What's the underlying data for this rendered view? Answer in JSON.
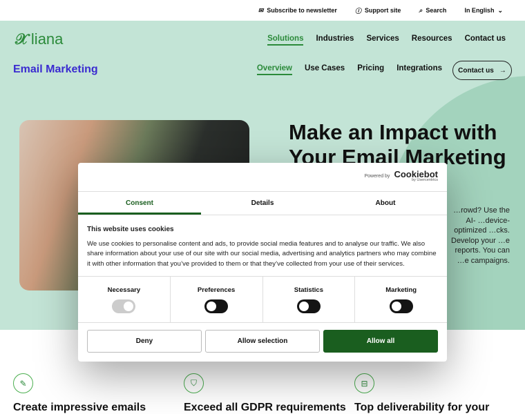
{
  "topbar": {
    "newsletter": "Subscribe to newsletter",
    "support": "Support site",
    "search": "Search",
    "language": "In English"
  },
  "brand": {
    "name": "liana",
    "accent": "#2b8a3a"
  },
  "nav": [
    "Solutions",
    "Industries",
    "Services",
    "Resources",
    "Contact us"
  ],
  "product": {
    "title": "Email Marketing",
    "subnav": [
      "Overview",
      "Use Cases",
      "Pricing",
      "Integrations"
    ],
    "contact": "Contact us"
  },
  "hero": {
    "title": "Make an Impact with Your Email Marketing",
    "lead": "…rowd? Use the AI- …device-optimized …cks. Develop your …e reports. You can …e campaigns."
  },
  "cookie": {
    "powered": "Powered by",
    "brand": "Cookiebot",
    "brand_sub": "by Usercentrics",
    "tabs": [
      "Consent",
      "Details",
      "About"
    ],
    "heading": "This website uses cookies",
    "text": "We use cookies to personalise content and ads, to provide social media features and to analyse our traffic. We also share information about your use of our site with our social media, advertising and analytics partners who may combine it with other information that you’ve provided to them or that they’ve collected from your use of their services.",
    "toggles": [
      "Necessary",
      "Preferences",
      "Statistics",
      "Marketing"
    ],
    "deny": "Deny",
    "allow_selection": "Allow selection",
    "allow_all": "Allow all"
  },
  "features": [
    "Create impressive emails",
    "Exceed all GDPR requirements",
    "Top deliverability for your"
  ]
}
